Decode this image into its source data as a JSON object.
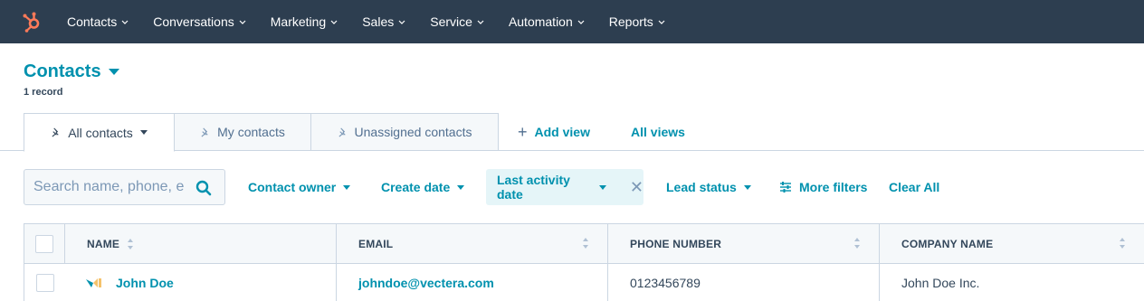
{
  "topnav": {
    "items": [
      {
        "label": "Contacts"
      },
      {
        "label": "Conversations"
      },
      {
        "label": "Marketing"
      },
      {
        "label": "Sales"
      },
      {
        "label": "Service"
      },
      {
        "label": "Automation"
      },
      {
        "label": "Reports"
      }
    ]
  },
  "page": {
    "title": "Contacts",
    "record_count": "1 record"
  },
  "views": {
    "tabs": [
      {
        "label": "All contacts",
        "active": true
      },
      {
        "label": "My contacts"
      },
      {
        "label": "Unassigned contacts"
      }
    ],
    "add_view": "Add view",
    "all_views": "All views"
  },
  "filters": {
    "search_placeholder": "Search name, phone, e",
    "contact_owner": "Contact owner",
    "create_date": "Create date",
    "last_activity_date": "Last activity date",
    "lead_status": "Lead status",
    "more_filters": "More filters",
    "clear_all": "Clear All"
  },
  "table": {
    "columns": [
      "NAME",
      "EMAIL",
      "PHONE NUMBER",
      "COMPANY NAME"
    ],
    "rows": [
      {
        "name": "John Doe",
        "email": "johndoe@vectera.com",
        "phone": "0123456789",
        "company": "John Doe Inc."
      }
    ]
  },
  "colors": {
    "nav_bg": "#2d3e50",
    "accent": "#0091ae",
    "brand": "#ff7a59",
    "text": "#33475b"
  }
}
